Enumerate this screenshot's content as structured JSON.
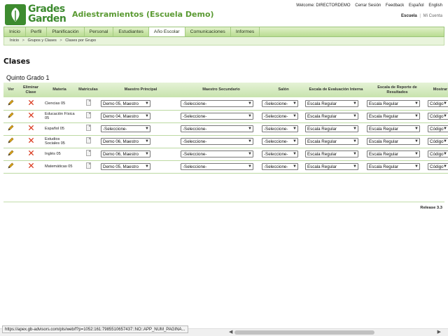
{
  "header": {
    "logo_line1": "Grades",
    "logo_line2": "Garden",
    "app_title": "Adiestramientos (Escuela Demo)",
    "top_links": [
      "Welcome: DIRECTORDEMO",
      "Cerrar Sesión",
      "Feedback",
      "Español",
      "English"
    ],
    "school_link": "Escuela",
    "school_sep": "|",
    "mine_link": "Mi Cuenta"
  },
  "nav": {
    "tabs": [
      "Inicio",
      "Perfil",
      "Planificación",
      "Personal",
      "Estudiantes",
      "Año Escolar",
      "Comunicaciones",
      "Informes"
    ],
    "active_index": 5
  },
  "breadcrumb": {
    "items": [
      "Inicio",
      "Grupos y Clases",
      "Clases por Grupo"
    ],
    "separator": ">"
  },
  "page": {
    "title": "Clases",
    "section_title": "Quinto Grado 1"
  },
  "table": {
    "headers": [
      "Ver",
      "Eliminar Clase",
      "Materia",
      "Matrículas",
      "Maestro Principal",
      "Maestro Secundario",
      "Salón",
      "Escala de Evaluación Interna",
      "Escala de Reporte de Resultados",
      "Mostrar en Inf."
    ],
    "rows": [
      {
        "subject": "Ciencias 05",
        "maestro": "Demo 05, Maestro",
        "secundario": "-Seleccione-",
        "salon": "-Seleccione-",
        "eval": "Escala Regular",
        "reporte": "Escala Regular",
        "mostrar": "Código"
      },
      {
        "subject": "Educación Física 05",
        "maestro": "Demo 04, Maestro",
        "secundario": "-Seleccione-",
        "salon": "-Seleccione-",
        "eval": "Escala Regular",
        "reporte": "Escala Regular",
        "mostrar": "Código"
      },
      {
        "subject": "Español 05",
        "maestro": "-Seleccione-",
        "secundario": "-Seleccione-",
        "salon": "-Seleccione-",
        "eval": "Escala Regular",
        "reporte": "Escala Regular",
        "mostrar": "Código"
      },
      {
        "subject": "Estudios Sociales 05",
        "maestro": "Demo 06, Maestro",
        "secundario": "-Seleccione-",
        "salon": "-Seleccione-",
        "eval": "Escala Regular",
        "reporte": "Escala Regular",
        "mostrar": "Código"
      },
      {
        "subject": "Inglés 05",
        "maestro": "Demo 06, Maestro",
        "secundario": "-Seleccione-",
        "salon": "-Seleccione-",
        "eval": "Escala Regular",
        "reporte": "Escala Regular",
        "mostrar": "Código"
      },
      {
        "subject": "Matemáticas 05",
        "maestro": "Demo 05, Maestro",
        "secundario": "-Seleccione-",
        "salon": "-Seleccione-",
        "eval": "Escala Regular",
        "reporte": "Escala Regular",
        "mostrar": "Código"
      }
    ]
  },
  "footer": {
    "release": "Release 3.3"
  },
  "status": {
    "url": "https://apex.gb-advisors.com/pls/web/f?p=1052:161:7985510657437::NO::APP_NUM_PAGINA..."
  },
  "colors": {
    "brand_green": "#3d8b2f",
    "title_green": "#5a9a32",
    "nav_bg": "#b8dc91",
    "edit_icon": "#d9a21a",
    "delete_icon": "#d9361a"
  }
}
